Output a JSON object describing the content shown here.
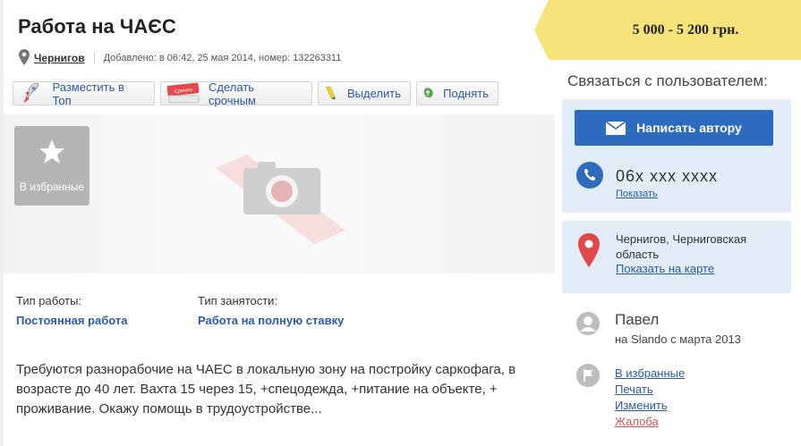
{
  "listing": {
    "title": "Работа на ЧАЄС",
    "city": "Чернигов",
    "added": "Добавлено: в 06:42, 25 мая 2014, номер: 132263311"
  },
  "actions": {
    "top": "Разместить в Топ",
    "urgent": "Сделать срочным",
    "urgent_sticker": "Срочно",
    "highlight": "Выделить",
    "raise": "Поднять"
  },
  "photo": {
    "favorite": "В избранные"
  },
  "params": [
    {
      "label": "Тип работы:",
      "value": "Постоянная работа"
    },
    {
      "label": "Тип занятости:",
      "value": "Работа на полную ставку"
    }
  ],
  "description": "Требуются разнорабочие на ЧАЕС в локальную зону на постройку саркофага, в возрасте до 40 лет. Вахта 15 через 15, +спецодежда, +питание на объекте, + проживание. Окажу помощь в трудоустройстве...",
  "price": "5 000 - 5 200 грн.",
  "contact": {
    "title": "Связаться с пользователем:",
    "write_button": "Написать автору",
    "phone": "06x xxx xxxx",
    "phone_show": "Показать",
    "location": "Чернигов, Черниговская область",
    "map_link": "Показать на карте"
  },
  "user": {
    "name": "Павел",
    "since": "на Slando с марта 2013"
  },
  "links": {
    "favorite": "В избранные",
    "print": "Печать",
    "edit": "Изменить",
    "report": "Жалоба"
  },
  "colors": {
    "link": "#2a5aa8",
    "price_bg": "#f6e37a",
    "primary_button": "#2d6bbf",
    "contact_box_bg": "#e2ecf6",
    "danger": "#d9534f"
  }
}
